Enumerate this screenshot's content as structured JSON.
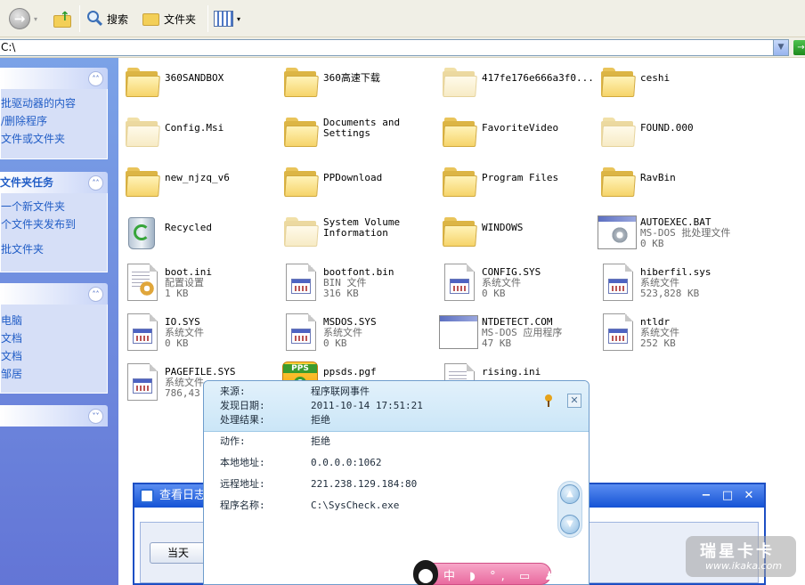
{
  "toolbar": {
    "search_label": "搜索",
    "folders_label": "文件夹"
  },
  "address": {
    "path": "C:\\"
  },
  "left_panels": [
    {
      "title": "",
      "items": [
        "批驱动器的内容",
        "/删除程序",
        "文件或文件夹"
      ]
    },
    {
      "title": "文件夹任务",
      "items": [
        "一个新文件夹",
        "个文件夹发布到",
        "批文件夹"
      ]
    },
    {
      "title": "",
      "items": [
        "电脑",
        "文档",
        "文档",
        "邹居"
      ]
    },
    {
      "title": "",
      "items": []
    }
  ],
  "files": [
    {
      "name": "360SANDBOX",
      "type": "folder"
    },
    {
      "name": "360高速下载",
      "type": "folder"
    },
    {
      "name": "417fe176e666a3f0...",
      "type": "folder-faded"
    },
    {
      "name": "ceshi",
      "type": "folder"
    },
    {
      "name": "Config.Msi",
      "type": "folder-faded"
    },
    {
      "name": "Documents and",
      "name2": "Settings",
      "type": "folder"
    },
    {
      "name": "FavoriteVideo",
      "type": "folder"
    },
    {
      "name": "FOUND.000",
      "type": "folder-faded"
    },
    {
      "name": "new_njzq_v6",
      "type": "folder"
    },
    {
      "name": "PPDownload",
      "type": "folder"
    },
    {
      "name": "Program Files",
      "type": "folder"
    },
    {
      "name": "RavBin",
      "type": "folder"
    },
    {
      "name": "Recycled",
      "type": "recycle"
    },
    {
      "name": "System Volume",
      "name2": "Information",
      "type": "folder-faded"
    },
    {
      "name": "WINDOWS",
      "type": "folder"
    },
    {
      "name": "AUTOEXEC.BAT",
      "desc": "MS-DOS 批处理文件",
      "size": "0 KB",
      "type": "bat"
    },
    {
      "name": "boot.ini",
      "desc": "配置设置",
      "size": "1 KB",
      "type": "ini"
    },
    {
      "name": "bootfont.bin",
      "desc": "BIN 文件",
      "size": "316 KB",
      "type": "sys"
    },
    {
      "name": "CONFIG.SYS",
      "desc": "系统文件",
      "size": "0 KB",
      "type": "sys"
    },
    {
      "name": "hiberfil.sys",
      "desc": "系统文件",
      "size": "523,828 KB",
      "type": "sys"
    },
    {
      "name": "IO.SYS",
      "desc": "系统文件",
      "size": "0 KB",
      "type": "sys"
    },
    {
      "name": "MSDOS.SYS",
      "desc": "系统文件",
      "size": "0 KB",
      "type": "sys"
    },
    {
      "name": "NTDETECT.COM",
      "desc": "MS-DOS 应用程序",
      "size": "47 KB",
      "type": "com"
    },
    {
      "name": "ntldr",
      "desc": "系统文件",
      "size": "252 KB",
      "type": "sys"
    },
    {
      "name": "PAGEFILE.SYS",
      "desc": "系统文件",
      "size": "786,43",
      "type": "sys"
    },
    {
      "name": "ppsds.pgf",
      "desc": "",
      "size": "",
      "type": "pps"
    },
    {
      "name": "rising.ini",
      "desc": "",
      "size": "",
      "type": "ini"
    }
  ],
  "log_window": {
    "title": "查看日志",
    "today_button": "当天"
  },
  "popup": {
    "source_label": "来源:",
    "source_value": "程序联网事件",
    "date_label": "发现日期:",
    "date_value": "2011-10-14 17:51:21",
    "result_label": "处理结果:",
    "result_value": "拒绝",
    "action_label": "动作:",
    "action_value": "拒绝",
    "local_label": "本地地址:",
    "local_value": "0.0.0.0:1062",
    "remote_label": "远程地址:",
    "remote_value": "221.238.129.184:80",
    "program_label": "程序名称:",
    "program_value": "C:\\SysCheck.exe"
  },
  "ime": {
    "glyphs": "中 ◗ °, ▭ ♟ ✎"
  },
  "watermark": {
    "big": "瑞星卡卡",
    "small": "www.ikaka.com"
  },
  "colors": {
    "taskpane": "#6f8fdf",
    "link": "#215dc6",
    "popup_header": "#d4ebf8",
    "title_bar": "#1d5ad6"
  }
}
